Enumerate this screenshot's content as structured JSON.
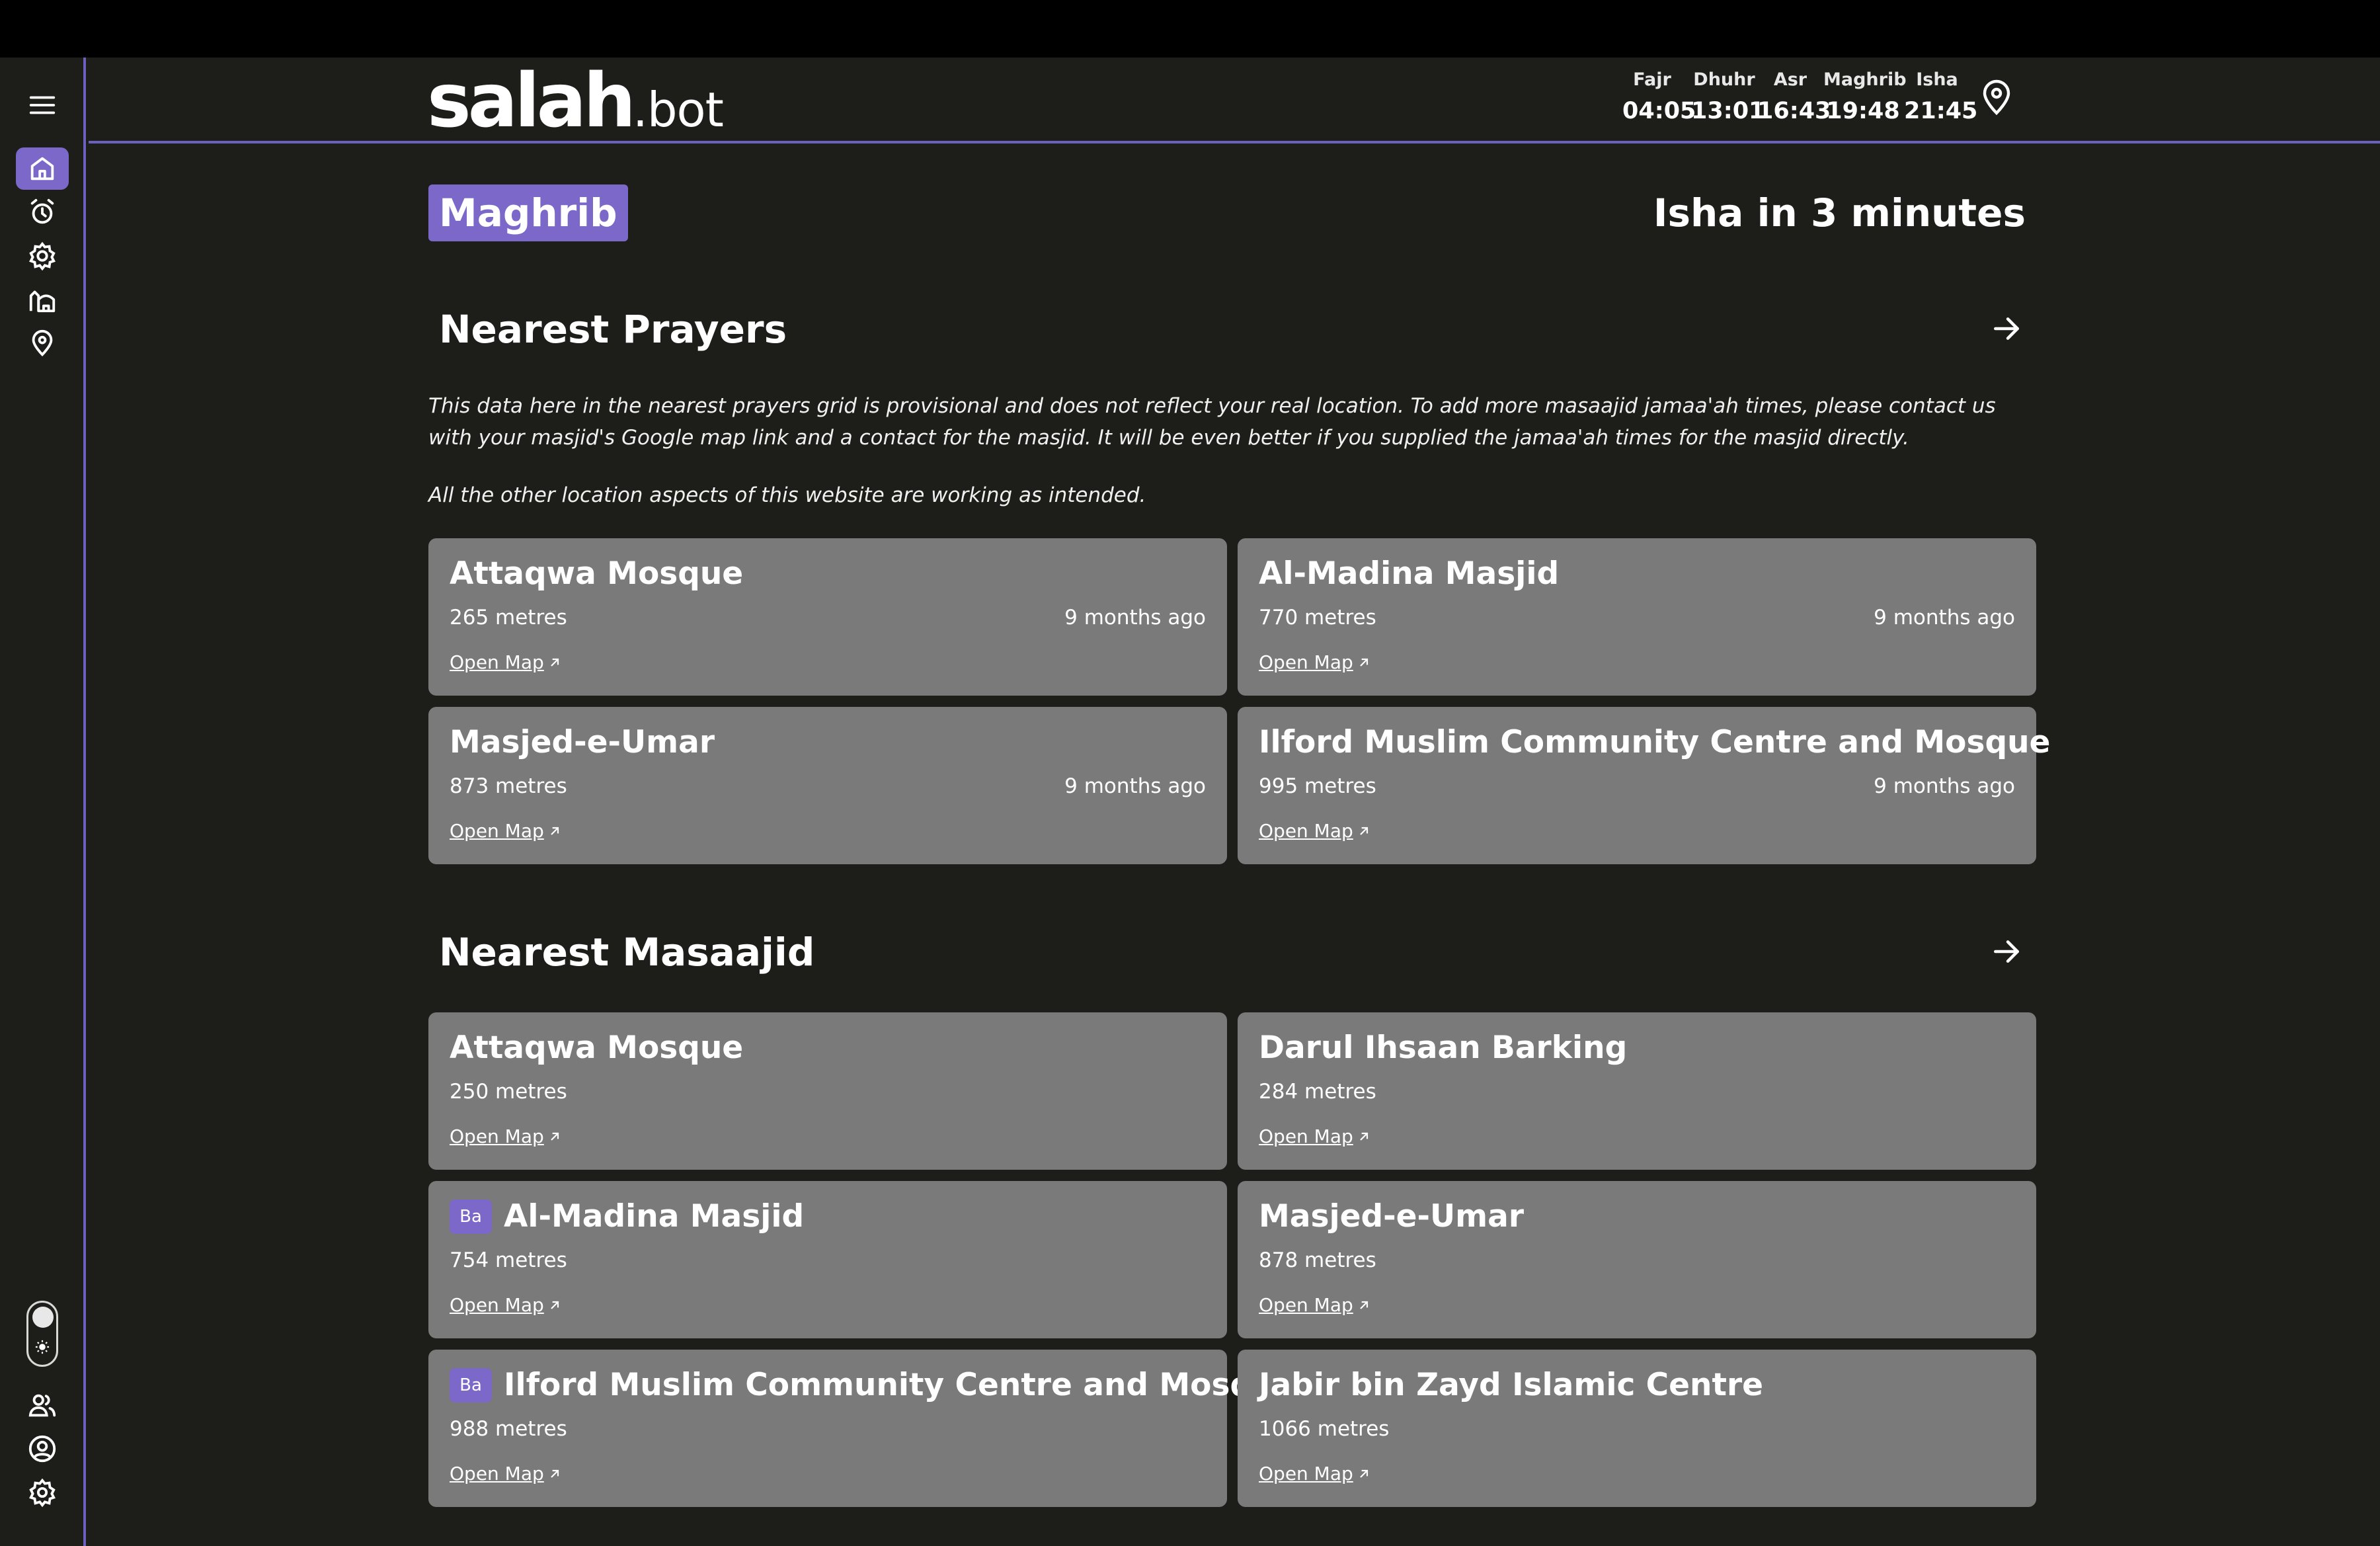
{
  "app": {
    "logo_main": "salah",
    "logo_tld": ".bot"
  },
  "prayer_times": [
    {
      "name": "Fajr",
      "time": "04:05"
    },
    {
      "name": "Dhuhr",
      "time": "13:01"
    },
    {
      "name": "Asr",
      "time": "16:43"
    },
    {
      "name": "Maghrib",
      "time": "19:48"
    },
    {
      "name": "Isha",
      "time": "21:45"
    }
  ],
  "status": {
    "current_prayer": "Maghrib",
    "next_prayer": "Isha in 3 minutes"
  },
  "nearest_prayers": {
    "title": "Nearest Prayers",
    "notice": "This data here in the nearest prayers grid is provisional and does not reflect your real location. To add more masaajid jamaa'ah times, please contact us with your masjid's Google map link and a contact for the masjid. It will be even better if you supplied the jamaa'ah times for the masjid directly.",
    "notice2": "All the other location aspects of this website are working as intended.",
    "cards": [
      {
        "name": "Attaqwa Mosque",
        "distance": "265 metres",
        "updated": "9 months ago",
        "map_label": "Open Map"
      },
      {
        "name": "Al-Madina Masjid",
        "distance": "770 metres",
        "updated": "9 months ago",
        "map_label": "Open Map"
      },
      {
        "name": "Masjed-e-Umar",
        "distance": "873 metres",
        "updated": "9 months ago",
        "map_label": "Open Map"
      },
      {
        "name": "Ilford Muslim Community Centre and Mosque",
        "distance": "995 metres",
        "updated": "9 months ago",
        "map_label": "Open Map"
      }
    ]
  },
  "nearest_masaajid": {
    "title": "Nearest Masaajid",
    "cards": [
      {
        "name": "Attaqwa Mosque",
        "distance": "250 metres",
        "map_label": "Open Map"
      },
      {
        "name": "Darul Ihsaan Barking",
        "distance": "284 metres",
        "map_label": "Open Map"
      },
      {
        "name": "Al-Madina Masjid",
        "distance": "754 metres",
        "map_label": "Open Map",
        "badge": "Ba"
      },
      {
        "name": "Masjed-e-Umar",
        "distance": "878 metres",
        "map_label": "Open Map"
      },
      {
        "name": "Ilford Muslim Community Centre and Mosque",
        "distance": "988 metres",
        "map_label": "Open Map",
        "badge": "Ba"
      },
      {
        "name": "Jabir bin Zayd Islamic Centre",
        "distance": "1066 metres",
        "map_label": "Open Map"
      }
    ]
  },
  "colors": {
    "accent": "#7b68c9",
    "background": "#1d1e19",
    "card": "#7a7a7a",
    "divider": "#6b5fbf"
  }
}
